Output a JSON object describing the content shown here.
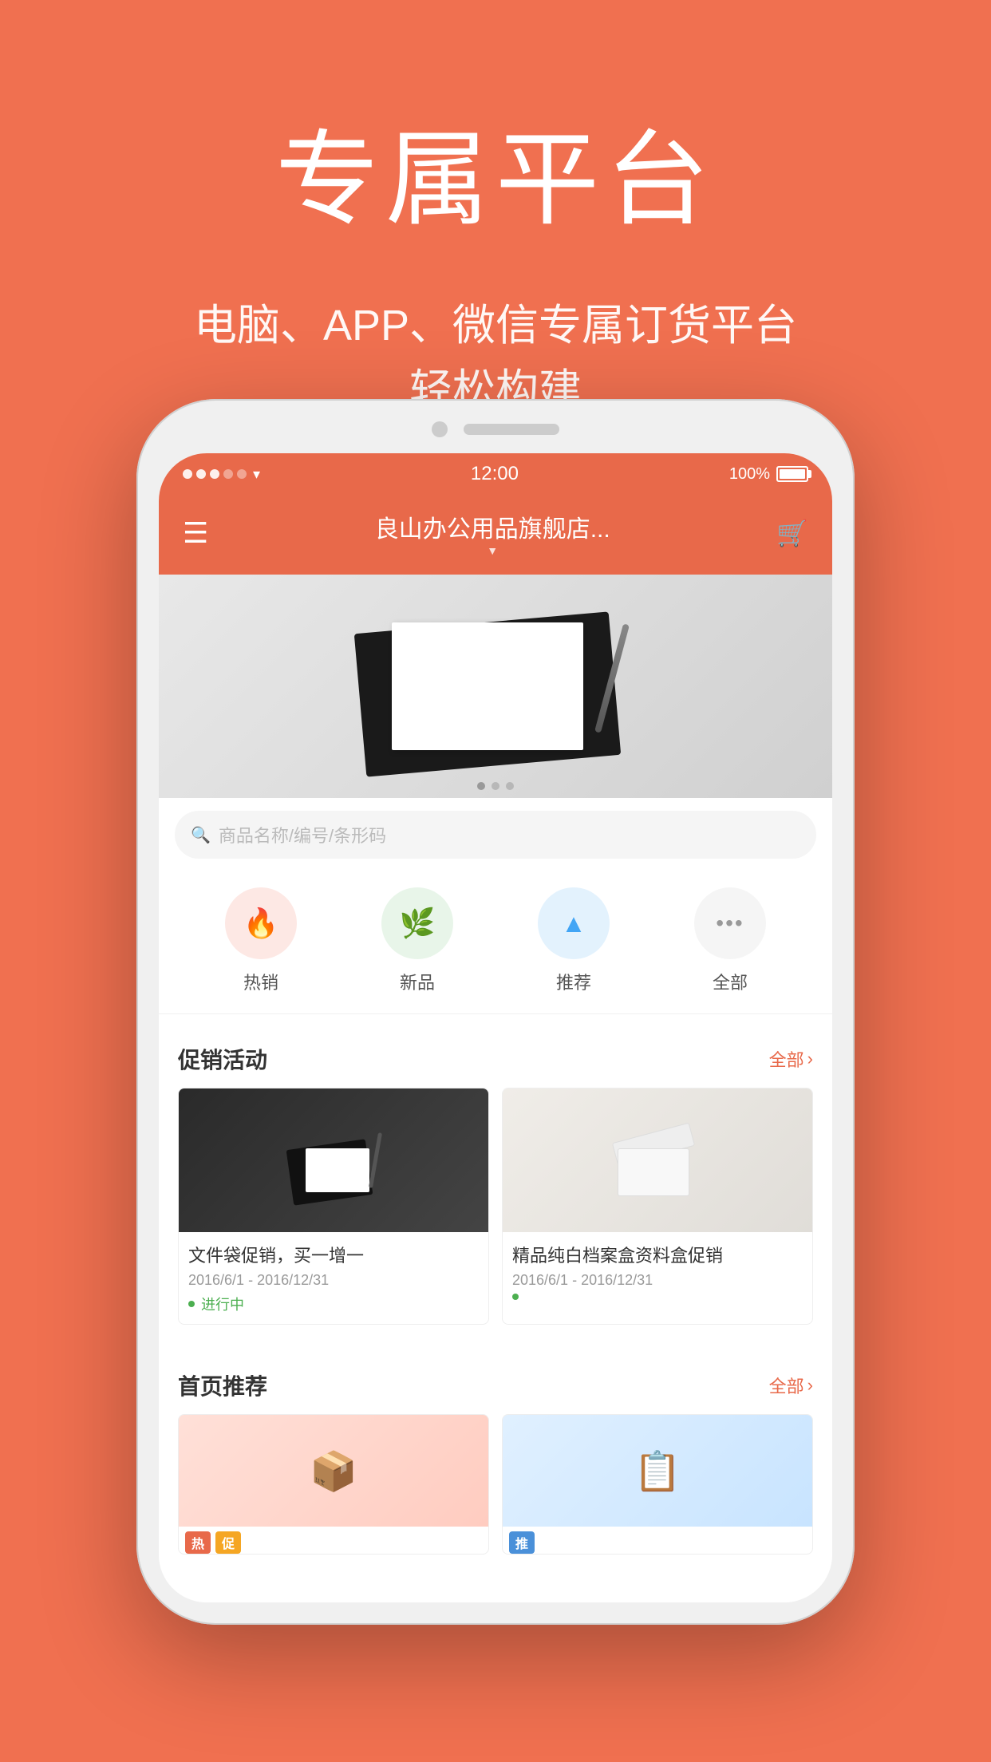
{
  "hero": {
    "title": "专属平台",
    "subtitle_line1": "电脑、APP、微信专属订货平台",
    "subtitle_line2": "轻松构建"
  },
  "phone": {
    "status_bar": {
      "time": "12:00",
      "battery": "100%",
      "wifi_icon": "wifi"
    },
    "header": {
      "title": "良山办公用品旗舰店...",
      "menu_icon": "≡",
      "cart_icon": "🛒"
    },
    "search": {
      "placeholder": "商品名称/编号/条形码"
    },
    "categories": [
      {
        "id": "hot",
        "label": "热销",
        "icon": "🔥"
      },
      {
        "id": "new",
        "label": "新品",
        "icon": "🌿"
      },
      {
        "id": "rec",
        "label": "推荐",
        "icon": "▲"
      },
      {
        "id": "all",
        "label": "全部",
        "icon": "···"
      }
    ],
    "promotions": {
      "section_title": "促销活动",
      "more_label": "全部",
      "items": [
        {
          "name": "文件袋促销，买一增一",
          "date": "2016/6/1 - 2016/12/31",
          "status": "进行中"
        },
        {
          "name": "精品纯白档案盒资料盒促销",
          "date": "2016/6/1 - 2016/12/31",
          "status": "•"
        }
      ]
    },
    "recommended": {
      "section_title": "首页推荐",
      "more_label": "全部",
      "items": [
        {
          "badges": [
            "热",
            "促"
          ]
        },
        {
          "badges": [
            "推"
          ]
        }
      ]
    }
  },
  "colors": {
    "brand_orange": "#E8694A",
    "bg_orange": "#F07050",
    "text_white": "#ffffff",
    "status_green": "#4CAF50"
  }
}
